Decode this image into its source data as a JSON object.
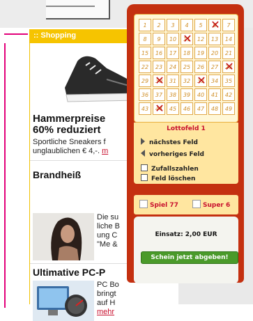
{
  "shopping": {
    "header": ":: Shopping",
    "promo1": {
      "title_line1": "Hammerpreise",
      "title_line2": "60% reduziert",
      "text_line1": "Sportliche Sneakers f",
      "text_line2": "unglaublichen € 4,-.",
      "link": "m"
    },
    "promo2": {
      "title": "Brandheiß",
      "text_lines": [
        "Die su",
        "liche B",
        "ung C",
        "\"Me &"
      ]
    },
    "promo3": {
      "title": "Ultimative PC-P",
      "text_lines": [
        "PC Bo",
        "bringt",
        "auf H"
      ],
      "link": "mehr"
    }
  },
  "lotto": {
    "numbers": [
      1,
      2,
      3,
      4,
      5,
      6,
      7,
      8,
      9,
      10,
      11,
      12,
      13,
      14,
      15,
      16,
      17,
      18,
      19,
      20,
      21,
      22,
      23,
      24,
      25,
      26,
      27,
      28,
      29,
      30,
      31,
      32,
      33,
      34,
      35,
      36,
      37,
      38,
      39,
      40,
      41,
      42,
      43,
      44,
      45,
      46,
      47,
      48,
      49
    ],
    "crossed": [
      6,
      11,
      28,
      30,
      33,
      44
    ],
    "field_label": "Lottofeld 1",
    "next_label": "nächstes Feld",
    "prev_label": "vorheriges Feld",
    "random_label": "Zufallszahlen",
    "delete_label": "Feld löschen",
    "spiel77_label": "Spiel 77",
    "super6_label": "Super 6",
    "einsatz": "Einsatz: 2,00 EUR",
    "submit_label": "Schein jetzt abgeben!"
  },
  "colors": {
    "panel_red": "#c43010",
    "accent_yellow": "#f6c400",
    "link_red": "#c8102e",
    "submit_green": "#4a9a2a"
  }
}
